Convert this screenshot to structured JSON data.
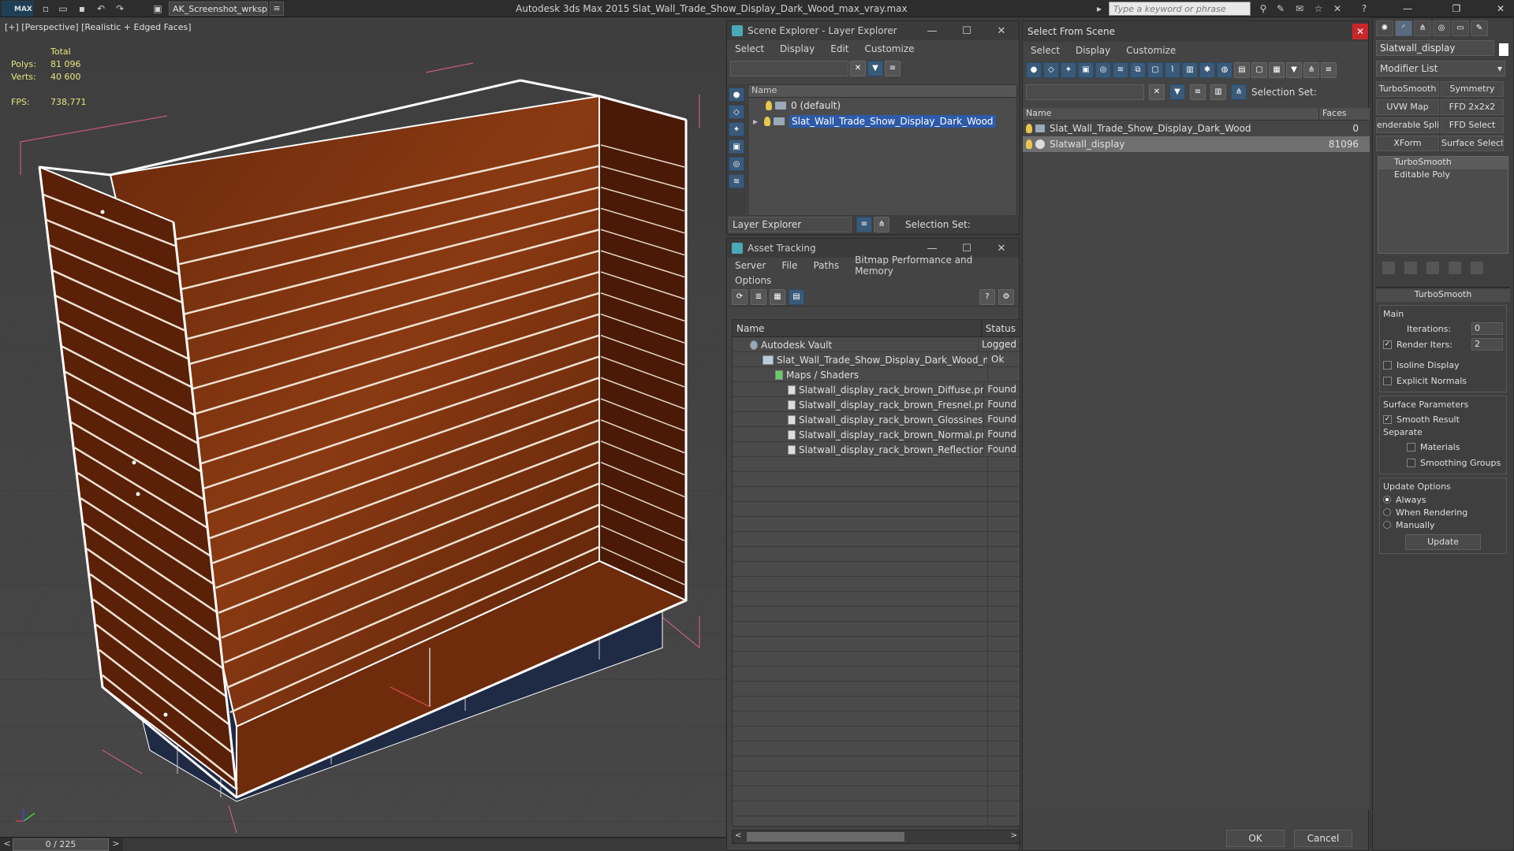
{
  "app": {
    "title": "Autodesk 3ds Max  2015    Slat_Wall_Trade_Show_Display_Dark_Wood_max_vray.max",
    "workspace": "AK_Screenshot_wrksp",
    "search_placeholder": "Type a keyword or phrase",
    "logo": "MAX"
  },
  "viewport": {
    "label": "[+] [Perspective] [Realistic + Edged Faces]",
    "stats": {
      "total_label": "Total",
      "polys_label": "Polys:",
      "polys_value": "81 096",
      "verts_label": "Verts:",
      "verts_value": "40 600",
      "fps_label": "FPS:",
      "fps_value": "738,771"
    },
    "colors": {
      "wood": "#6b2a0c",
      "base": "#1f2a44",
      "wire": "#ffffff"
    }
  },
  "timeline": {
    "frame": "0 / 225"
  },
  "scene_explorer": {
    "title": "Scene Explorer - Layer Explorer",
    "menu": [
      "Select",
      "Display",
      "Edit",
      "Customize"
    ],
    "column": "Name",
    "rows": [
      "0 (default)",
      "Slat_Wall_Trade_Show_Display_Dark_Wood"
    ],
    "footer_dropdown": "Layer Explorer",
    "selection_set": "Selection Set:"
  },
  "asset_tracking": {
    "title": "Asset Tracking",
    "menu": [
      "Server",
      "File",
      "Paths",
      "Bitmap Performance and Memory"
    ],
    "menu2": "Options",
    "col_name": "Name",
    "col_status": "Status",
    "rows": [
      {
        "name": "Autodesk Vault",
        "status": "Logged"
      },
      {
        "name": "Slat_Wall_Trade_Show_Display_Dark_Wood_max...",
        "status": "Ok"
      },
      {
        "name": "Maps / Shaders",
        "status": ""
      },
      {
        "name": "Slatwall_display_rack_brown_Diffuse.png",
        "status": "Found"
      },
      {
        "name": "Slatwall_display_rack_brown_Fresnel.png",
        "status": "Found"
      },
      {
        "name": "Slatwall_display_rack_brown_Glossiness.png",
        "status": "Found"
      },
      {
        "name": "Slatwall_display_rack_brown_Normal.png",
        "status": "Found"
      },
      {
        "name": "Slatwall_display_rack_brown_Reflection.png",
        "status": "Found"
      }
    ]
  },
  "select_from_scene": {
    "title": "Select From Scene",
    "menu": [
      "Select",
      "Display",
      "Customize"
    ],
    "selection_set": "Selection Set:",
    "col_name": "Name",
    "col_faces": "Faces",
    "rows": [
      {
        "name": "Slat_Wall_Trade_Show_Display_Dark_Wood",
        "faces": "0"
      },
      {
        "name": "Slatwall_display",
        "faces": "81096"
      }
    ],
    "ok": "OK",
    "cancel": "Cancel"
  },
  "command_panel": {
    "object_name": "Slatwall_display",
    "modifier_list": "Modifier List",
    "modifier_buttons": [
      "TurboSmooth",
      "Symmetry",
      "UVW Map",
      "FFD 2x2x2",
      "enderable Splir",
      "FFD Select",
      "XForm",
      "Surface Select"
    ],
    "stack": [
      "TurboSmooth",
      "Editable Poly"
    ],
    "rollout": "TurboSmooth",
    "main_label": "Main",
    "iterations_label": "Iterations:",
    "iterations_value": "0",
    "render_iters_label": "Render Iters:",
    "render_iters_value": "2",
    "isoline": "Isoline Display",
    "explicit_normals": "Explicit Normals",
    "surface_params": "Surface Parameters",
    "smooth_result": "Smooth Result",
    "separate": "Separate",
    "materials": "Materials",
    "smoothing_groups": "Smoothing Groups",
    "update_options": "Update Options",
    "always": "Always",
    "when_rendering": "When Rendering",
    "manually": "Manually",
    "update": "Update"
  }
}
